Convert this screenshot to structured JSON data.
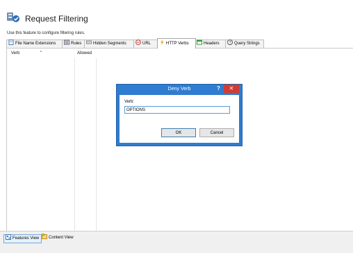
{
  "header": {
    "title": "Request Filtering",
    "subtitle": "Use this feature to configure filtering rules."
  },
  "tabs": [
    {
      "label": "File Name Extensions",
      "icon": "file-icon"
    },
    {
      "label": "Rules",
      "icon": "rules-icon"
    },
    {
      "label": "Hidden Segments",
      "icon": "hidden-segments-icon"
    },
    {
      "label": "URL",
      "icon": "url-icon"
    },
    {
      "label": "HTTP Verbs",
      "icon": "lightning-icon",
      "active": true
    },
    {
      "label": "Headers",
      "icon": "headers-icon"
    },
    {
      "label": "Query Strings",
      "icon": "question-icon"
    }
  ],
  "table": {
    "columns": [
      "Verb",
      "Allowed"
    ]
  },
  "dialog": {
    "title": "Deny Verb",
    "help": "?",
    "close": "✕",
    "verb_label": "Verb:",
    "verb_value": "OPTIONS",
    "ok_label": "OK",
    "cancel_label": "Cancel"
  },
  "view_tabs": {
    "features_view": "Features View",
    "content_view": "Content View"
  },
  "colors": {
    "dialog_accent": "#2f7cd0",
    "close_red": "#d33b30"
  }
}
